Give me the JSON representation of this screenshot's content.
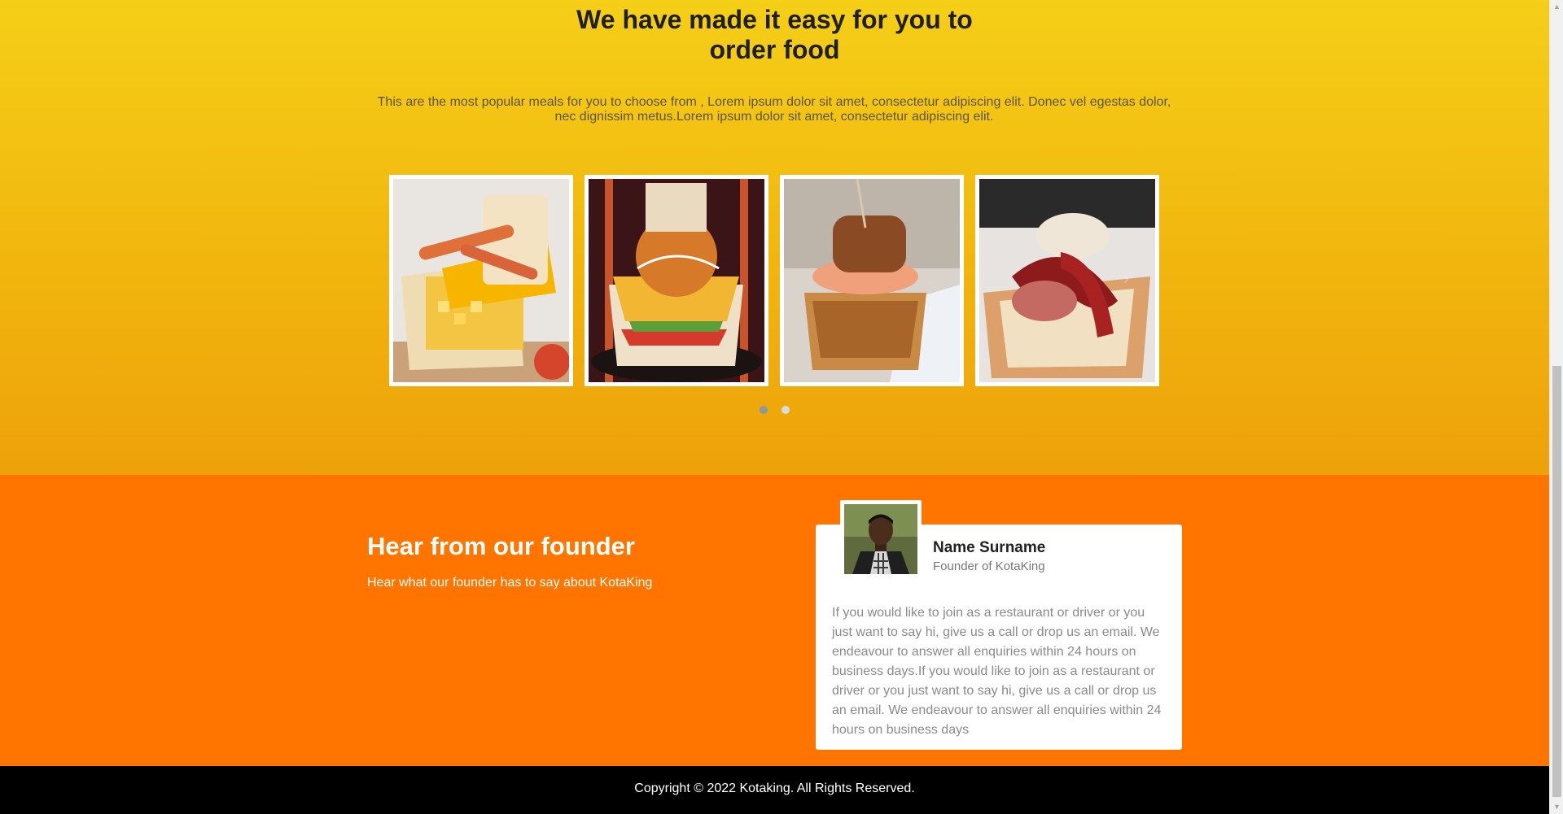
{
  "meals": {
    "heading": "We have made it easy for you to order food",
    "heading_line1": "We have made it easy for you to",
    "heading_line2": "order food",
    "intro": "This are the most popular meals for you to choose from , Lorem ipsum dolor sit amet, consectetur adipiscing elit. Donec vel egestas dolor, nec dignissim metus.Lorem ipsum dolor sit amet, consectetur adipiscing elit.",
    "cards": [
      {
        "image": "kota-chips-cheese-sausage"
      },
      {
        "image": "kota-loaded-sauce-dark-background"
      },
      {
        "image": "kota-wrapped-with-string"
      },
      {
        "image": "kota-russian-sausage"
      }
    ],
    "carousel_dots": [
      {
        "active": true
      },
      {
        "active": false
      }
    ],
    "next_icon": "chevron-right-icon"
  },
  "founder": {
    "heading": "Hear from our founder",
    "subheading": "Hear what our founder has to say about KotaKing",
    "card": {
      "name": "Name Surname",
      "role": "Founder of KotaKing",
      "quote": "If you would like to join as a restaurant or driver or you just want to say hi, give us a call or drop us an email. We endeavour to answer all enquiries within 24 hours on business days.If you would like to join as a restaurant or driver or you just want to say hi, give us a call or drop us an email. We endeavour to answer all enquiries within 24 hours on business days",
      "avatar": "founder-photo"
    }
  },
  "footer": {
    "copyright": "Copyright © 2022 Kotaking. All Rights Reserved."
  },
  "colors": {
    "meals_bg_top": "#f5cf18",
    "meals_bg_bottom": "#eea10a",
    "founder_bg": "#ff7500",
    "footer_bg": "#000000"
  }
}
